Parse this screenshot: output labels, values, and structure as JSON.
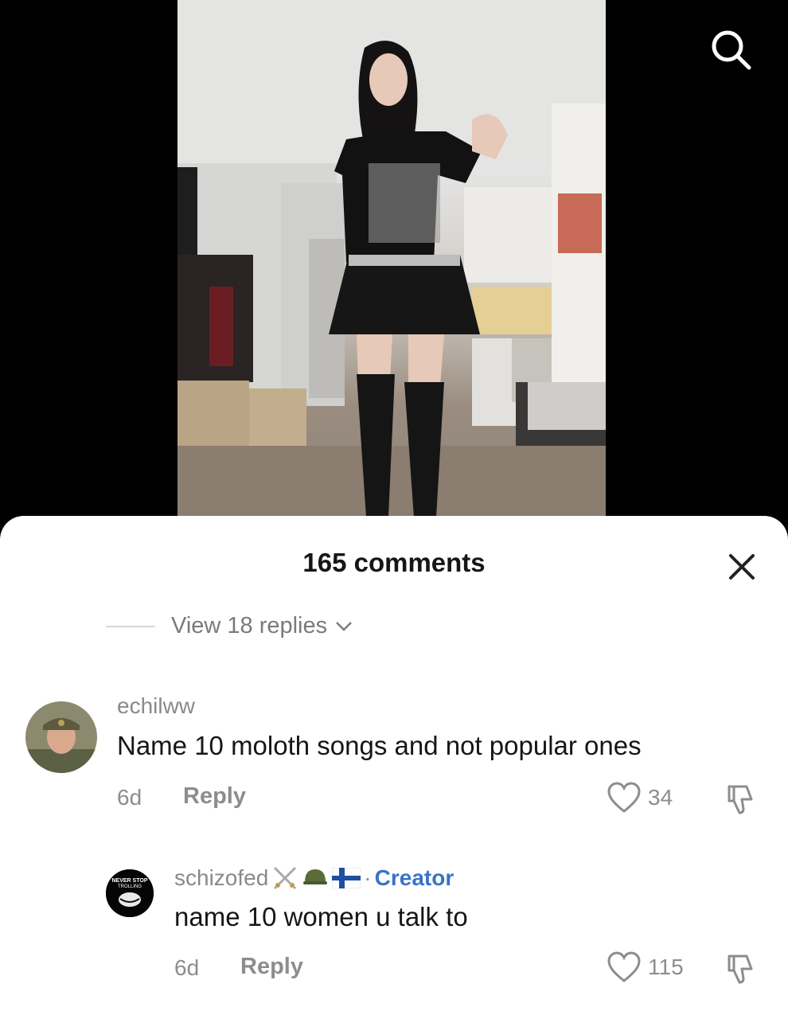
{
  "header": {
    "comments_count": "165 comments"
  },
  "thread": {
    "view_replies_label": "View 18 replies"
  },
  "comments": [
    {
      "username": "echilww",
      "text": "Name 10 moloth songs and not popular ones",
      "age": "6d",
      "reply_label": "Reply",
      "likes": "34"
    },
    {
      "username": "schizofed",
      "badge_separator": "·",
      "badge_creator": "Creator",
      "text": "name 10 women u talk to",
      "age": "6d",
      "reply_label": "Reply",
      "likes": "115"
    }
  ],
  "avatar2_text": {
    "line1": "NEVER STOP",
    "line2": "TROLLING"
  },
  "icons": {
    "search": "search-icon",
    "close": "close-icon",
    "heart": "heart-icon",
    "dislike": "dislike-icon",
    "chevron": "chevron-down-icon"
  },
  "colors": {
    "creator": "#3a73c6",
    "sheet_bg": "#ffffff",
    "muted": "#8d8d8d"
  }
}
